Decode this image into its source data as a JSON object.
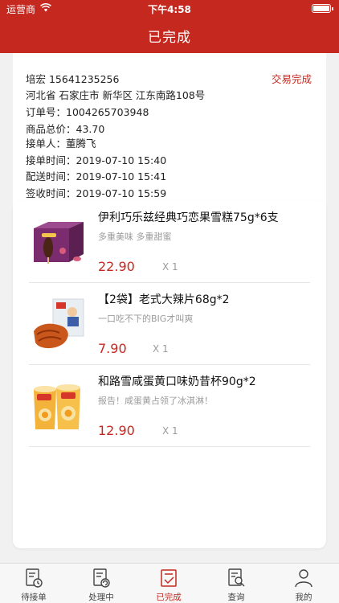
{
  "status_bar": {
    "carrier": "运营商",
    "time": "下午4:58"
  },
  "nav": {
    "title": "已完成"
  },
  "order": {
    "customer": "培宏 15641235256",
    "address": "河北省 石家庄市 新华区 江东南路108号",
    "status": "交易完成",
    "order_no_label": "订单号：",
    "order_no": "1004265703948",
    "total_label": "商品总价：",
    "total": "43.70",
    "receiver_label": "接单人：",
    "receiver": "董腾飞",
    "accept_time_label": "接单时间：",
    "accept_time": "2019-07-10 15:40",
    "deliver_time_label": "配送时间：",
    "deliver_time": "2019-07-10 15:41",
    "sign_time_label": "签收时间：",
    "sign_time": "2019-07-10 15:59"
  },
  "items": [
    {
      "name": "伊利巧乐兹经典巧恋果雪糕75g*6支",
      "desc": "多重美味 多重甜蜜",
      "price": "22.90",
      "qty": "X 1"
    },
    {
      "name": "【2袋】老式大辣片68g*2",
      "desc": "一口吃不下的BIG才叫爽",
      "price": "7.90",
      "qty": "X 1"
    },
    {
      "name": "和路雪咸蛋黄口味奶昔杯90g*2",
      "desc": "报告！咸蛋黄占领了冰淇淋！",
      "price": "12.90",
      "qty": "X 1"
    }
  ],
  "tabs": [
    {
      "label": "待接单",
      "icon": "pending-order-icon"
    },
    {
      "label": "处理中",
      "icon": "processing-icon"
    },
    {
      "label": "已完成",
      "icon": "completed-icon",
      "active": true
    },
    {
      "label": "查询",
      "icon": "search-doc-icon"
    },
    {
      "label": "我的",
      "icon": "profile-icon"
    }
  ],
  "colors": {
    "brand": "#c5281f",
    "background": "#f1f1f1"
  }
}
